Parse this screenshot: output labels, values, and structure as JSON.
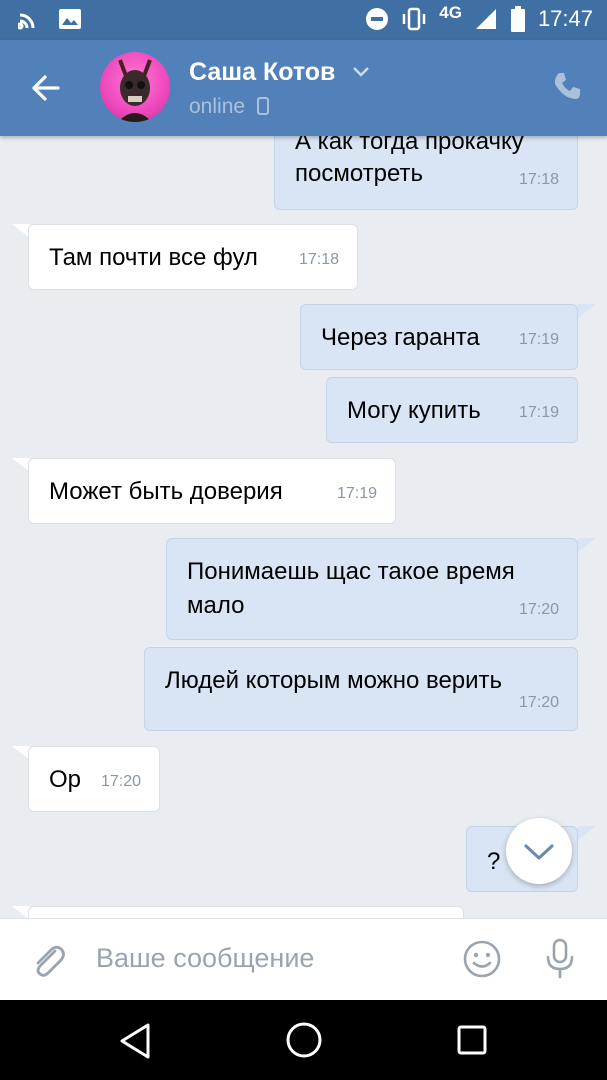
{
  "status_bar": {
    "network": "4G",
    "time": "17:47"
  },
  "header": {
    "contact_name": "Саша Котов",
    "status": "online"
  },
  "messages": [
    {
      "dir": "out",
      "lines": [
        "А как тогда прокачку",
        "посмотреть"
      ],
      "time": "17:18"
    },
    {
      "dir": "in",
      "lines": [
        "Там почти все фул"
      ],
      "time": "17:18"
    },
    {
      "dir": "out",
      "lines": [
        "Через гаранта"
      ],
      "time": "17:19"
    },
    {
      "dir": "out",
      "lines": [
        "Могу купить"
      ],
      "time": "17:19"
    },
    {
      "dir": "in",
      "lines": [
        "Может быть доверия"
      ],
      "time": "17:19"
    },
    {
      "dir": "out",
      "lines": [
        "Понимаешь щас такое время",
        "мало"
      ],
      "time": "17:20"
    },
    {
      "dir": "out",
      "lines": [
        "Людей которым можно верить"
      ],
      "time": "17:20"
    },
    {
      "dir": "in",
      "lines": [
        "Ор"
      ],
      "time": "17:20"
    },
    {
      "dir": "out",
      "lines": [
        "?"
      ],
      "time": ""
    }
  ],
  "composer": {
    "placeholder": "Ваше сообщение"
  },
  "colors": {
    "header": "#5181b8",
    "status_bar": "#3f6fa3",
    "chat_background": "#e9edf2",
    "outgoing_bubble": "#d9e5f4",
    "incoming_bubble": "#ffffff"
  },
  "icons": {
    "back": "arrow-left-icon",
    "chevron": "chevron-down-icon",
    "phone": "phone-icon",
    "attach": "paperclip-icon",
    "emoji": "smile-icon",
    "mic": "microphone-icon",
    "scroll_down": "chevron-down-icon"
  }
}
